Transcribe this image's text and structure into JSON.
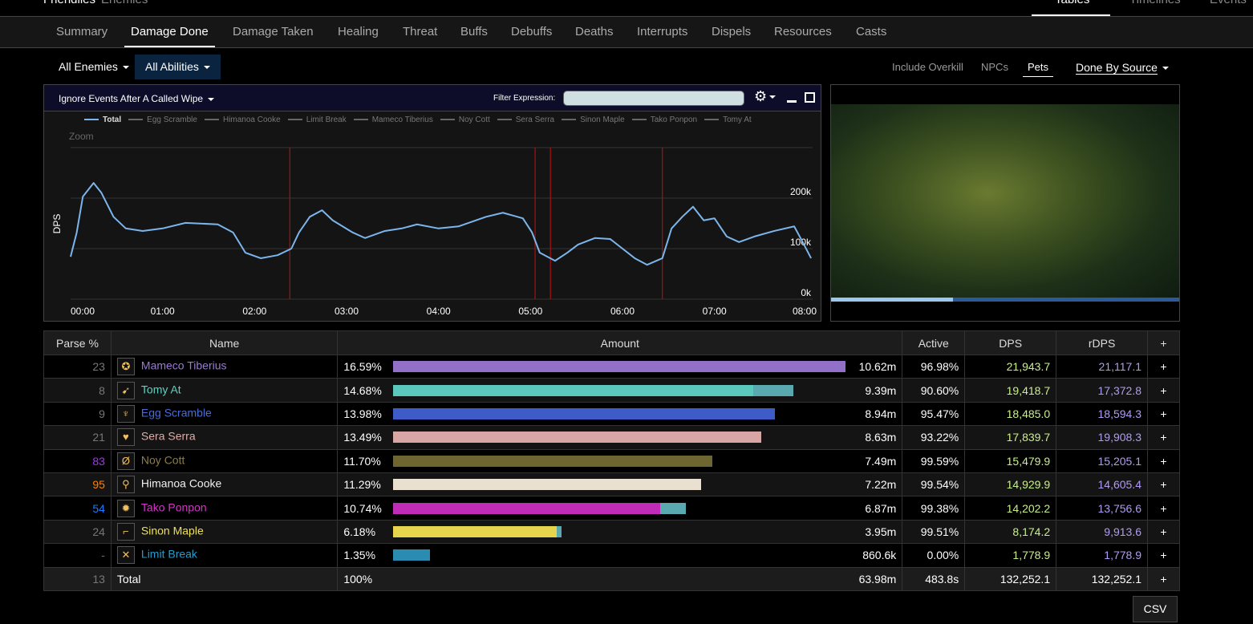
{
  "top": {
    "left": [
      "Friendlies",
      "Enemies"
    ],
    "right": [
      "Tables",
      "Timelines",
      "Events"
    ]
  },
  "tabs": [
    "Summary",
    "Damage Done",
    "Damage Taken",
    "Healing",
    "Threat",
    "Buffs",
    "Debuffs",
    "Deaths",
    "Interrupts",
    "Dispels",
    "Resources",
    "Casts"
  ],
  "active_tab": "Damage Done",
  "filters": {
    "enemies": "All Enemies",
    "abilities": "All Abilities",
    "include_overkill": "Include Overkill",
    "npcs": "NPCs",
    "pets": "Pets",
    "done_by": "Done By Source"
  },
  "chart_panel": {
    "wipe_option": "Ignore Events After A Called Wipe",
    "filter_label": "Filter Expression:",
    "filter_value": "",
    "zoom_label": "Zoom"
  },
  "chart_data": {
    "type": "line",
    "ylabel": "DPS",
    "legend": [
      "Total",
      "Egg Scramble",
      "Himanoa Cooke",
      "Limit Break",
      "Mameco Tiberius",
      "Noy Cott",
      "Sera Serra",
      "Sinon Maple",
      "Tako Ponpon",
      "Tomy At"
    ],
    "x_ticks": [
      "00:00",
      "01:00",
      "02:00",
      "03:00",
      "04:00",
      "05:00",
      "06:00",
      "07:00",
      "08:00"
    ],
    "y_ticks": [
      "0k",
      "100k",
      "200k"
    ],
    "xlim_seconds": [
      0,
      484
    ],
    "ylim": [
      0,
      300000
    ],
    "grid": true,
    "legend_position": "top",
    "series": [
      {
        "name": "Total",
        "color": "#7cb5ec",
        "x": [
          0,
          4,
          8,
          15,
          20,
          28,
          36,
          47,
          60,
          75,
          96,
          106,
          114,
          124,
          135,
          144,
          149,
          156,
          164,
          171,
          184,
          192,
          205,
          216,
          226,
          240,
          253,
          271,
          282,
          295,
          301,
          306,
          316,
          324,
          331,
          342,
          352,
          360,
          368,
          376,
          386,
          392,
          399,
          406,
          413,
          420,
          428,
          436,
          446,
          459,
          472,
          477,
          483
        ],
        "y": [
          84,
          132,
          203,
          230,
          211,
          163,
          140,
          135,
          140,
          151,
          148,
          132,
          92,
          81,
          87,
          100,
          132,
          163,
          176,
          156,
          132,
          121,
          135,
          140,
          148,
          140,
          144,
          163,
          171,
          160,
          132,
          92,
          76,
          92,
          108,
          121,
          119,
          100,
          81,
          68,
          81,
          140,
          163,
          183,
          156,
          160,
          124,
          113,
          124,
          135,
          144,
          116,
          81
        ]
      }
    ],
    "markers_seconds": [
      143,
      303,
      313,
      386
    ],
    "marker_color": "#a01010"
  },
  "video": {
    "progress": 0.35
  },
  "table": {
    "headers": [
      "Parse %",
      "Name",
      "Amount",
      "Active",
      "DPS",
      "rDPS",
      "+"
    ],
    "rows": [
      {
        "parse": "23",
        "parse_color": "#777",
        "name": "Mameco Tiberius",
        "color": "#9a79d6",
        "icon": "ninja-icon",
        "glyph": "✪",
        "pct": "16.59%",
        "share": 16.59,
        "pet_share": 0,
        "bar": "#9370c8",
        "amount": "10.62m",
        "active": "96.98%",
        "dps": "21,943.7",
        "rdps": "21,117.1"
      },
      {
        "parse": "8",
        "parse_color": "#777",
        "name": "Tomy At",
        "color": "#5fd1c0",
        "icon": "machinist-icon",
        "glyph": "➹",
        "pct": "14.68%",
        "share": 14.68,
        "pet_share": 0.1,
        "bar": "#5cc7bd",
        "amount": "9.39m",
        "active": "90.60%",
        "dps": "19,418.7",
        "rdps": "17,372.8"
      },
      {
        "parse": "9",
        "parse_color": "#777",
        "name": "Egg Scramble",
        "color": "#4b6bd6",
        "icon": "dragoon-icon",
        "glyph": "♆",
        "pct": "13.98%",
        "share": 13.98,
        "pet_share": 0,
        "bar": "#3f5bc8",
        "amount": "8.94m",
        "active": "95.47%",
        "dps": "18,485.0",
        "rdps": "18,594.3"
      },
      {
        "parse": "21",
        "parse_color": "#777",
        "name": "Sera Serra",
        "color": "#e0aaa8",
        "icon": "dancer-icon",
        "glyph": "♥",
        "pct": "13.49%",
        "share": 13.49,
        "pet_share": 0,
        "bar": "#d8a6a4",
        "amount": "8.63m",
        "active": "93.22%",
        "dps": "17,839.7",
        "rdps": "19,908.3"
      },
      {
        "parse": "83",
        "parse_color": "#a335ee",
        "name": "Noy Cott",
        "color": "#8a7d4a",
        "icon": "reaper-icon",
        "glyph": "Ø",
        "pct": "11.70%",
        "share": 11.7,
        "pet_share": 0,
        "bar": "#6e6630",
        "amount": "7.49m",
        "active": "99.59%",
        "dps": "15,479.9",
        "rdps": "15,205.1"
      },
      {
        "parse": "95",
        "parse_color": "#ff8000",
        "name": "Himanoa Cooke",
        "color": "#f0f0f0",
        "icon": "white-mage-icon",
        "glyph": "⚲",
        "pct": "11.29%",
        "share": 11.29,
        "pet_share": 0,
        "bar": "#eae0d0",
        "amount": "7.22m",
        "active": "99.54%",
        "dps": "14,929.9",
        "rdps": "14,605.4"
      },
      {
        "parse": "54",
        "parse_color": "#1a7cff",
        "name": "Tako Ponpon",
        "color": "#d436c8",
        "icon": "summoner-icon",
        "glyph": "✹",
        "pct": "10.74%",
        "share": 10.74,
        "pet_share": 0.09,
        "bar": "#c02cb8",
        "amount": "6.87m",
        "active": "99.38%",
        "dps": "14,202.2",
        "rdps": "13,756.6"
      },
      {
        "parse": "24",
        "parse_color": "#777",
        "name": "Sinon Maple",
        "color": "#f0e050",
        "icon": "red-mage-icon",
        "glyph": "⌐",
        "pct": "6.18%",
        "share": 6.18,
        "pet_share": 0.03,
        "bar": "#e6d44c",
        "amount": "3.95m",
        "active": "99.51%",
        "dps": "8,174.2",
        "rdps": "9,913.6"
      },
      {
        "parse": "-",
        "parse_color": "#1a7cff",
        "name": "Limit Break",
        "color": "#2a9ac8",
        "icon": "limit-break-icon",
        "glyph": "✕",
        "pct": "1.35%",
        "share": 1.35,
        "pet_share": 0,
        "bar": "#2a8cb0",
        "amount": "860.6k",
        "active": "0.00%",
        "dps": "1,778.9",
        "rdps": "1,778.9"
      }
    ],
    "total": {
      "parse": "13",
      "name": "Total",
      "pct": "100%",
      "amount": "63.98m",
      "active": "483.8s",
      "dps": "132,252.1",
      "rdps": "132,252.1"
    },
    "pet_color": "#5aa8b0",
    "plus": "+"
  },
  "csv": "CSV"
}
